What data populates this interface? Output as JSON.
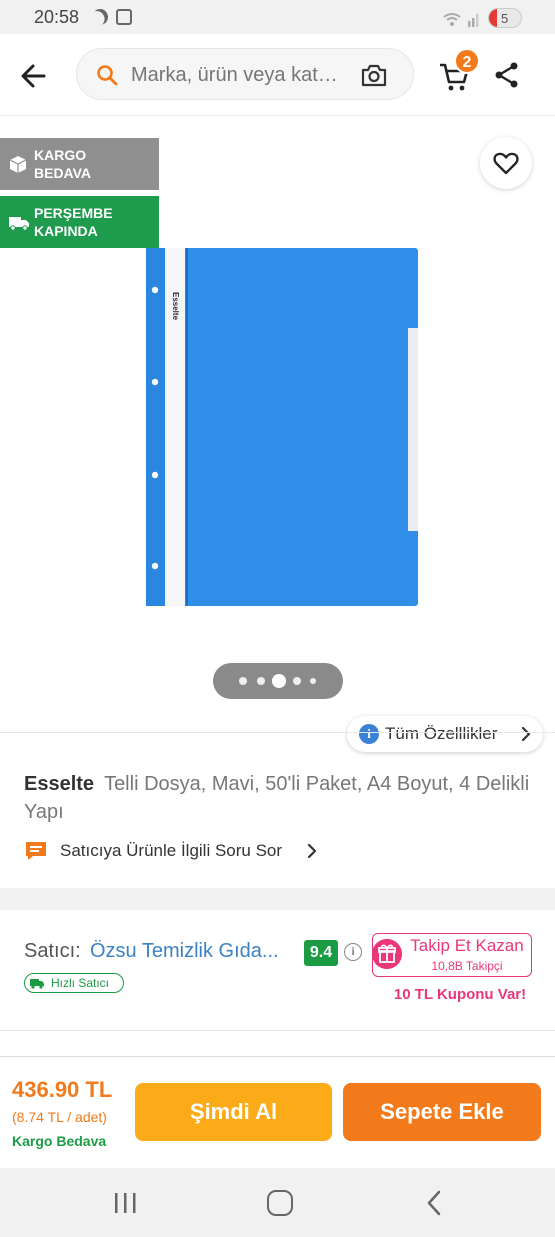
{
  "status_bar": {
    "time": "20:58",
    "battery": "5"
  },
  "header": {
    "search_placeholder": "Marka, ürün veya kat…",
    "cart_count": "2"
  },
  "badges": {
    "kargo": [
      "KARGO",
      "BEDAVA"
    ],
    "delivery": [
      "PERŞEMBE",
      "KAPINDA"
    ]
  },
  "gallery": {
    "dot_count": 5,
    "active_index": 2
  },
  "specs_button": "Tüm Özelllikler",
  "product": {
    "brand": "Esselte",
    "title": "Telli Dosya, Mavi, 50'li Paket, A4 Boyut, 4 Delikli Yapı",
    "ask_seller": "Satıcıya Ürünle İlgili Soru Sor",
    "image_label": "Esselte"
  },
  "seller": {
    "label": "Satıcı:",
    "name": "Özsu Temizlik Gıda...",
    "score": "9.4",
    "fast_badge": "Hızlı Satıcı",
    "follow_title": "Takip Et Kazan",
    "followers": "10,8B Takipçi",
    "coupon": "10 TL Kuponu Var!"
  },
  "purchase": {
    "price": "436.90 TL",
    "unit_price": "(8.74 TL / adet)",
    "shipping": "Kargo Bedava",
    "buy_now": "Şimdi Al",
    "add_to_cart": "Sepete Ekle"
  },
  "colors": {
    "accent": "#f27a1a",
    "buy_now": "#fbab18",
    "seller_score": "#1b9b44",
    "follow": "#e9377a",
    "product_blue": "#2f8ee8"
  }
}
